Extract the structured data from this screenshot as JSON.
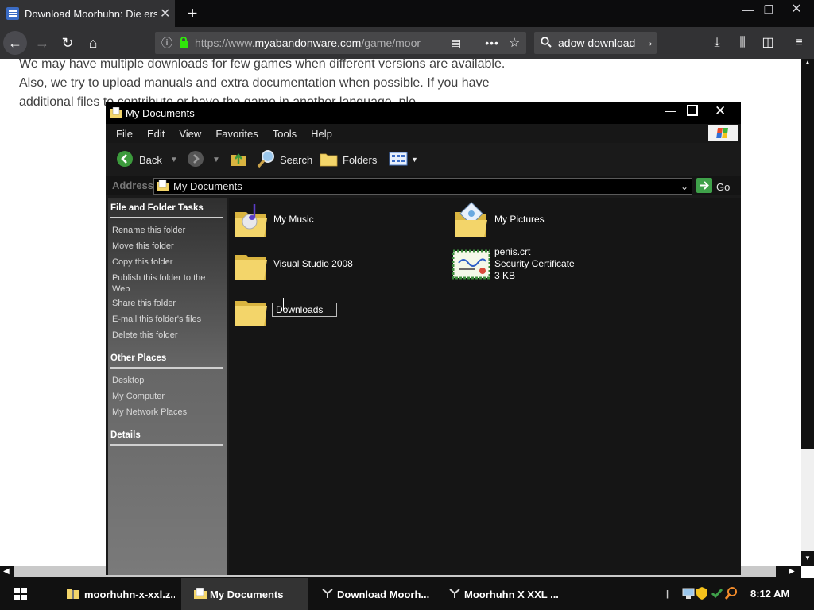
{
  "browser": {
    "tab_title": "Download Moorhuhn: Die erst",
    "url_prefix": "https://www.",
    "url_domain": "myabandonware.com",
    "url_path": "/game/moor",
    "search_text": "adow download"
  },
  "page": {
    "paragraph": "We may have multiple downloads for few games when different versions are available. Also, we try to upload manuals and extra documentation when possible. If you have additional files to contribute or have the game in another language, ple"
  },
  "explorer": {
    "title": "My Documents",
    "menu": [
      "File",
      "Edit",
      "View",
      "Favorites",
      "Tools",
      "Help"
    ],
    "toolbar": {
      "back": "Back",
      "search": "Search",
      "folders": "Folders"
    },
    "address_label": "Address",
    "address_value": "My Documents",
    "go_label": "Go",
    "tasks_header": "File and Folder Tasks",
    "tasks": [
      "Rename this folder",
      "Move this folder",
      "Copy this folder",
      "Publish this folder to the",
      "Web",
      "Share this folder",
      "E-mail this folder's files",
      "Delete this folder"
    ],
    "places_header": "Other Places",
    "places": [
      "Desktop",
      "My Computer",
      "My Network Places"
    ],
    "details_header": "Details",
    "items": {
      "my_music": "My Music",
      "my_pictures": "My Pictures",
      "visual_studio": "Visual Studio 2008",
      "cert_name": "penis.crt",
      "cert_type": "Security Certificate",
      "cert_size": "3 KB",
      "downloads": "Downloads"
    }
  },
  "taskbar": {
    "tasks": [
      "moorhuhn-x-xxl.z...",
      "My Documents",
      "Download Moorh...",
      "Moorhuhn X XXL ..."
    ],
    "clock": "8:12 AM"
  },
  "colors": {
    "folder": "#f3d56a",
    "folder_dark": "#d9b440",
    "go_green": "#3fa14a",
    "back_green": "#3c9a3c"
  }
}
